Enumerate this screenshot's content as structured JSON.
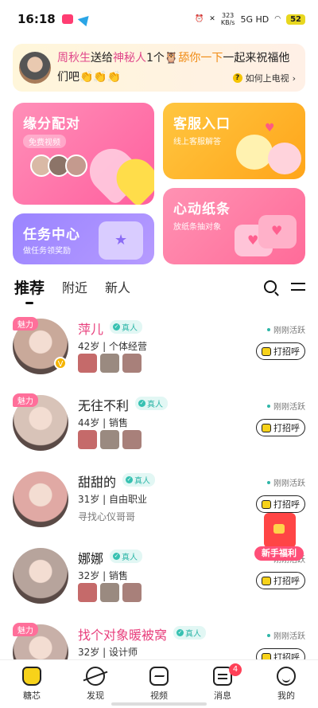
{
  "status_bar": {
    "time": "16:18",
    "net_speed_value": "323",
    "net_speed_unit": "KB/s",
    "signal": "5G HD",
    "battery": "52"
  },
  "banner": {
    "user_name": "周秋生",
    "action_text": "送给",
    "recipient": "神秘人",
    "gift_count": "1个",
    "gift_name": "舔你一下",
    "message": "一起来祝福他们吧",
    "emoji": "👏👏👏",
    "help_text": "如何上电视",
    "help_icon": "?"
  },
  "cards": {
    "match": {
      "title": "缘分配对",
      "subtitle": "免费视频"
    },
    "service": {
      "title": "客服入口",
      "subtitle": "线上客服解答"
    },
    "task": {
      "title": "任务中心",
      "subtitle": "做任务领奖励"
    },
    "note": {
      "title": "心动纸条",
      "subtitle": "放纸条抽对象"
    }
  },
  "tabs": [
    "推荐",
    "附近",
    "新人"
  ],
  "charm_label": "魅力",
  "verified_label": "真人",
  "active_label": "刚刚活跃",
  "greet_label": "打招呼",
  "users": [
    {
      "name": "萍儿",
      "info": "42岁 | 个体经营",
      "charm": true,
      "vip": true,
      "pink": true,
      "has_photos": true,
      "motto": "",
      "avatar_color": "#c9a99a"
    },
    {
      "name": "无往不利",
      "info": "44岁 | 销售",
      "charm": true,
      "vip": false,
      "pink": false,
      "has_photos": true,
      "motto": "",
      "avatar_color": "#d8c3b8"
    },
    {
      "name": "甜甜的",
      "info": "31岁 | 自由职业",
      "charm": false,
      "vip": false,
      "pink": false,
      "has_photos": false,
      "motto": "寻找心仪哥哥",
      "avatar_color": "#e0a9a4"
    },
    {
      "name": "娜娜",
      "info": "32岁 | 销售",
      "charm": false,
      "vip": false,
      "pink": false,
      "has_photos": true,
      "motto": "",
      "avatar_color": "#b7a49c"
    },
    {
      "name": "找个对象暖被窝",
      "info": "32岁 | 设计师",
      "charm": true,
      "vip": false,
      "pink": true,
      "has_photos": false,
      "motto": "",
      "avatar_color": "#c8b0a8"
    }
  ],
  "gift_float": {
    "label": "新手福利"
  },
  "nav": [
    {
      "label": "糖芯",
      "icon": "home-icon",
      "active": true
    },
    {
      "label": "发现",
      "icon": "planet-icon",
      "active": false
    },
    {
      "label": "视频",
      "icon": "video-icon",
      "active": false
    },
    {
      "label": "消息",
      "icon": "message-icon",
      "active": false,
      "badge": "4"
    },
    {
      "label": "我的",
      "icon": "smile-icon",
      "active": false
    }
  ],
  "colors": {
    "accent_pink": "#e8407d",
    "accent_yellow": "#f7d21a",
    "verified_teal": "#2eb6a8"
  }
}
